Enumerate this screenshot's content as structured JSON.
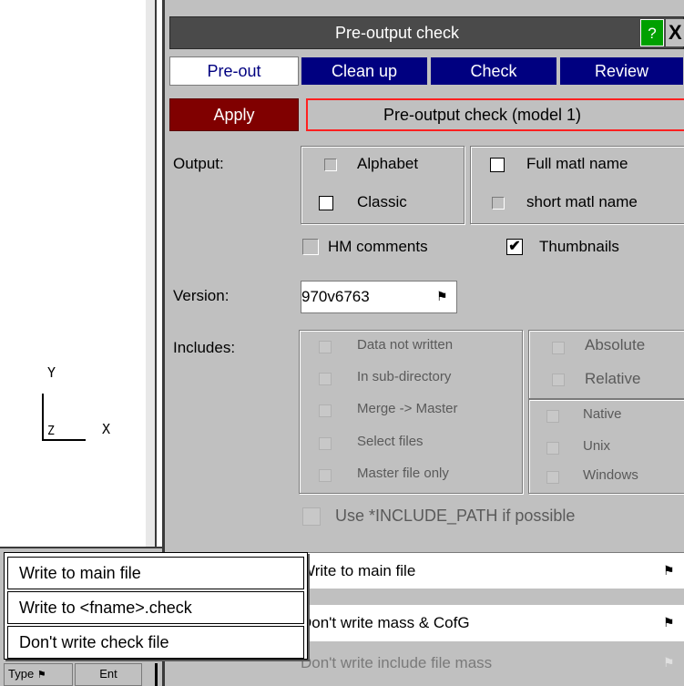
{
  "title": "Pre-output check",
  "help_label": "?",
  "close_label": "X",
  "tabs": [
    "Pre-out",
    "Clean up",
    "Check",
    "Review"
  ],
  "apply_label": "Apply",
  "status_text": "Pre-output check (model 1)",
  "output": {
    "label": "Output:",
    "alphabet": "Alphabet",
    "classic": "Classic",
    "full_matl": "Full matl name",
    "short_matl": "short matl name",
    "hm_comments": "HM comments",
    "thumbnails": "Thumbnails",
    "thumbnails_checked": true
  },
  "version": {
    "label": "Version:",
    "value": "970v6763"
  },
  "includes": {
    "label": "Includes:",
    "options": [
      "Data not written",
      "In sub-directory",
      "Merge -> Master",
      "Select files",
      "Master file only"
    ],
    "path_mode": [
      "Absolute",
      "Relative"
    ],
    "os": [
      "Native",
      "Unix",
      "Windows"
    ],
    "include_path": "Use *INCLUDE_PATH if possible"
  },
  "rows": {
    "write_main": "Write to main file",
    "mass_cofg": "Don't write mass & CofG",
    "include_mass": "Don't write include file mass"
  },
  "popup": [
    "Write to main file",
    "Write to <fname>.check",
    "Don't write check file"
  ],
  "axes": {
    "y": "Y",
    "x": "X",
    "z": "Z"
  },
  "bottom_toolbar": {
    "type": "Type",
    "ent": "Ent"
  }
}
